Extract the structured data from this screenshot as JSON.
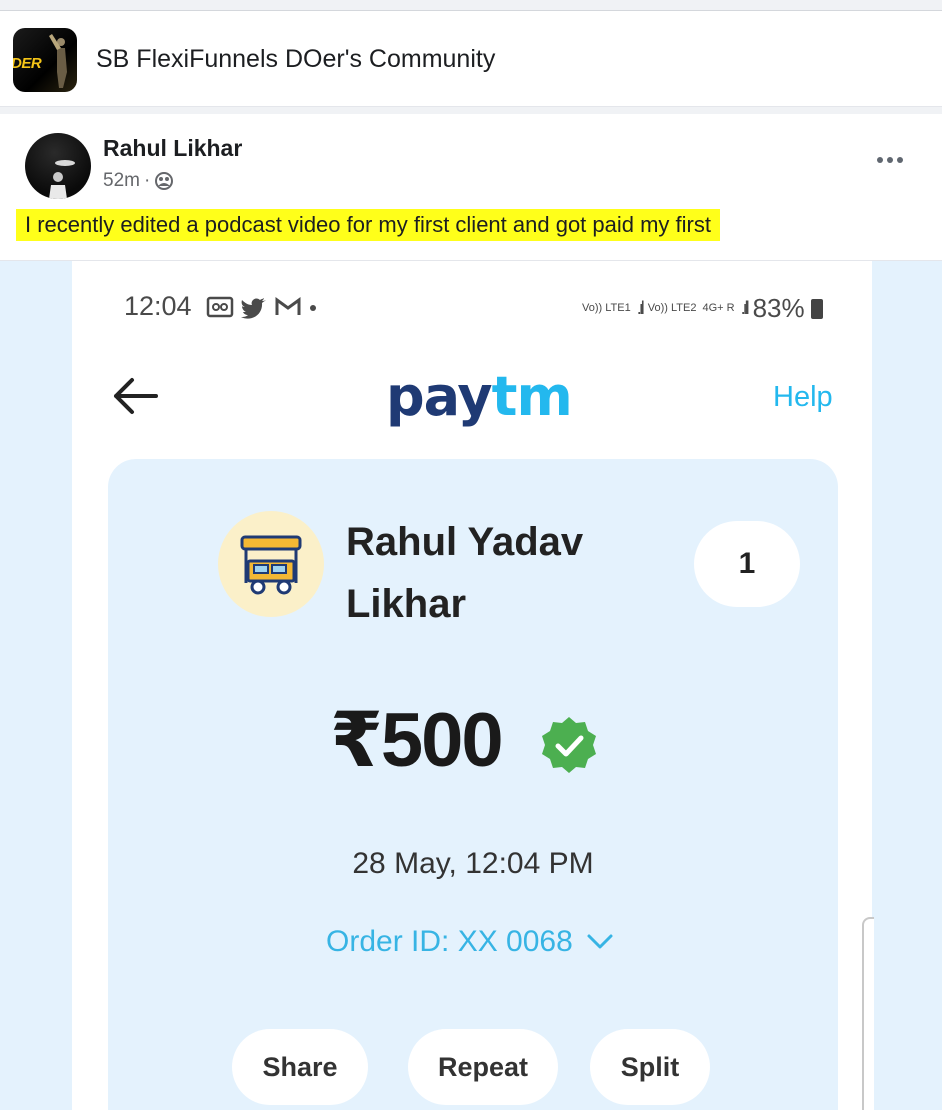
{
  "group": {
    "name": "SB FlexiFunnels DOer's Community",
    "avatar_text": "DER",
    "avatar_icon": "group-avatar-image"
  },
  "post": {
    "author": "Rahul Likhar",
    "time": "52m",
    "meta_separator": "·",
    "audience_icon": "group-audience-icon",
    "more_icon": "more-options-icon",
    "text": "I recently edited a podcast video for my first client and got paid my first"
  },
  "screenshot": {
    "status_bar": {
      "time": "12:04",
      "icons": [
        "gallery-icon",
        "twitter-icon",
        "gmail-icon",
        "dot-icon"
      ],
      "net1": "Vo)) LTE1",
      "net2": "Vo)) LTE2",
      "net3": "4G+ R",
      "battery": "83%"
    },
    "header": {
      "back_icon": "back-arrow-icon",
      "logo_pay": "pay",
      "logo_tm": "tm",
      "help": "Help"
    },
    "transaction": {
      "merchant_icon": "food-cart-icon",
      "merchant_name_line1": "Rahul Yadav",
      "merchant_name_line2": "Likhar",
      "count": "1",
      "amount": "₹500",
      "verified_icon": "verified-check-icon",
      "date": "28 May, 12:04 PM",
      "order_id": "Order ID: XX 0068",
      "order_chevron": "chevron-down-icon",
      "actions": [
        "Share",
        "Repeat",
        "Split"
      ]
    },
    "colors": {
      "paytm_navy": "#1f3a74",
      "paytm_blue": "#23b8ee",
      "card_bg": "#e4f2fd",
      "verified_green": "#4caf50",
      "highlight": "#ffff1a"
    }
  }
}
